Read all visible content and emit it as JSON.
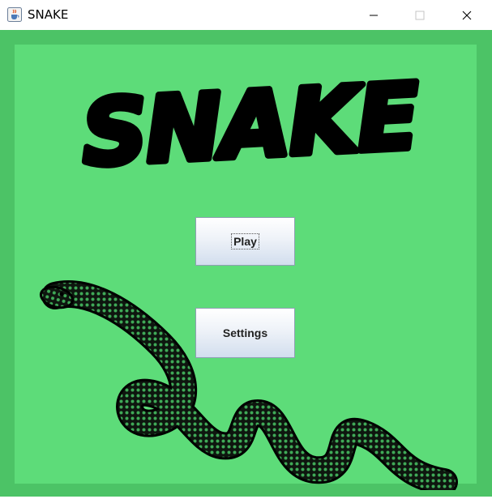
{
  "window": {
    "title": "SNAKE",
    "app_icon": "java-cup-icon",
    "controls": [
      "minimize-icon",
      "maximize-icon",
      "close-icon"
    ]
  },
  "logo": {
    "text": "SNAKE"
  },
  "menu": {
    "play_label": "Play",
    "settings_label": "Settings"
  },
  "colors": {
    "frame": "#4cc366",
    "panel": "#5ddc79",
    "logo": "#000000",
    "snake_spots": "#3fa957"
  }
}
